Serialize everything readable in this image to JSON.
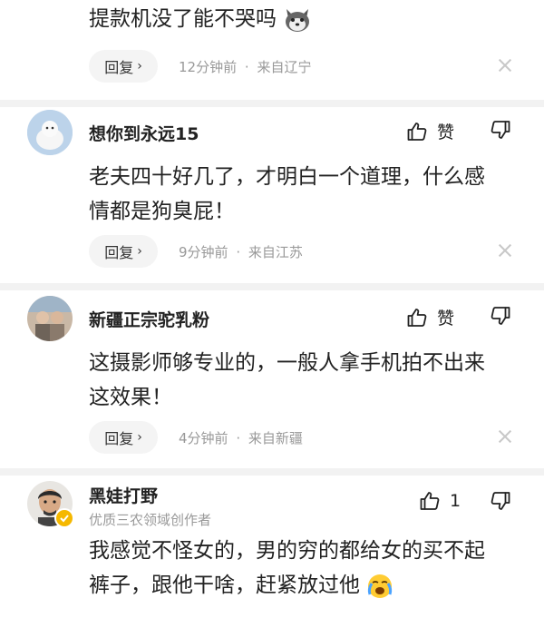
{
  "comments": [
    {
      "text_lines": [
        "提款机没了能不哭吗"
      ],
      "reply_label": "回复",
      "time": "12分钟前",
      "sep": "·",
      "location": "来自辽宁"
    },
    {
      "username": "想你到永远15",
      "like_label": "赞",
      "text_lines": [
        "老夫四十好几了，才明白一个道理，什么感",
        "情都是狗臭屁！"
      ],
      "reply_label": "回复",
      "time": "9分钟前",
      "sep": "·",
      "location": "来自江苏"
    },
    {
      "username": "新疆正宗驼乳粉",
      "like_label": "赞",
      "text_lines": [
        "这摄影师够专业的，一般人拿手机拍不出来",
        "这效果！"
      ],
      "reply_label": "回复",
      "time": "4分钟前",
      "sep": "·",
      "location": "来自新疆"
    },
    {
      "username": "黑娃打野",
      "subtitle": "优质三农领域创作者",
      "like_count": "1",
      "text_lines": [
        "我感觉不怪女的，男的穷的都给女的买不起",
        "裤子，跟他干啥，赶紧放过他"
      ]
    }
  ],
  "icons": {
    "emoji_husky": "husky-emoji-icon",
    "emoji_cry": "crying-emoji-icon",
    "like": "thumbs-up-icon",
    "dislike": "thumbs-down-icon",
    "close": "close-icon",
    "chevron": "chevron-right-icon",
    "verified": "verified-badge-icon"
  },
  "colors": {
    "text": "#222222",
    "meta": "#999999",
    "reply_bg": "#f4f4f4",
    "verified_badge": "#f5b800"
  }
}
